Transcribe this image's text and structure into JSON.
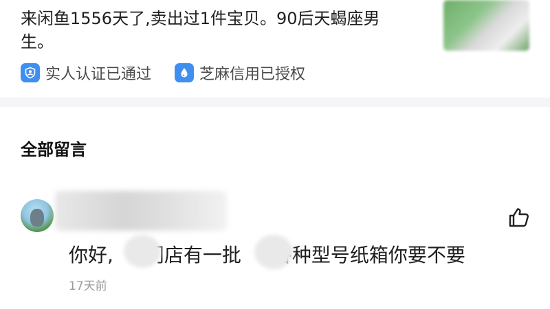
{
  "seller": {
    "bio": "来闲鱼1556天了,卖出过1件宝贝。90后天蝎座男生。",
    "badges": [
      {
        "label": "实人认证已通过",
        "icon": "person-verified-icon"
      },
      {
        "label": "芝麻信用已授权",
        "icon": "sesame-credit-icon"
      }
    ]
  },
  "comments_section": {
    "title": "全部留言",
    "comments": [
      {
        "message_parts": [
          "你好,",
          "门店有一批",
          "各种型号纸箱你要不要"
        ],
        "time": "17天前"
      }
    ]
  },
  "colors": {
    "badge_blue": "#3f8ff0",
    "text_primary": "#1f1f1f",
    "text_secondary": "#4a4a4a",
    "muted": "#9a9a9a",
    "divider": "#f5f5f7"
  }
}
